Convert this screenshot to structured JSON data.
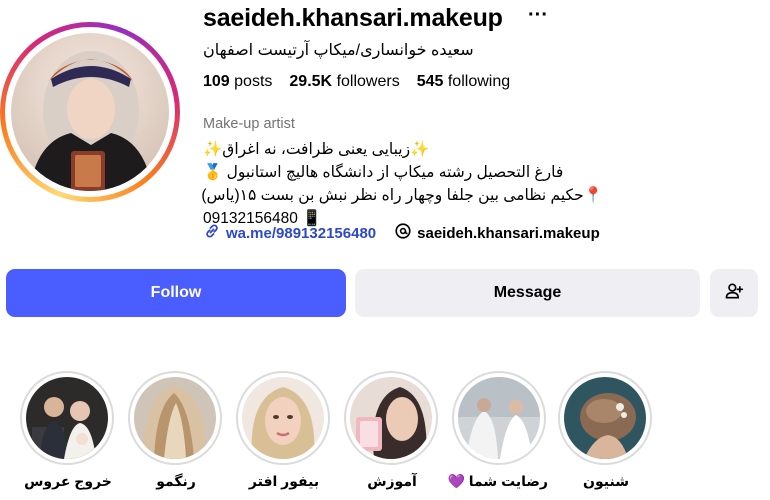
{
  "profile": {
    "username": "saeideh.khansari.makeup",
    "full_name": "سعیده خوانساری/میکاپ آرتیست اصفهان",
    "stats": {
      "posts_count": "109",
      "posts_label": "posts",
      "followers_count": "29.5K",
      "followers_label": "followers",
      "following_count": "545",
      "following_label": "following"
    },
    "category": "Make-up artist",
    "bio": [
      "✨زیبایی یعنی ظرافت، نه اغراق✨",
      "فارغ التحصیل رشته میکاپ از دانشگاه هالیچ استانبول 🥇",
      "📍حکیم نظامی بین جلفا وچهار راه نظر نبش بن بست ۱۵(یاس)",
      "09132156480 📱"
    ],
    "links": {
      "website": "wa.me/989132156480",
      "threads": "saeideh.khansari.makeup"
    }
  },
  "actions": {
    "follow_label": "Follow",
    "message_label": "Message"
  },
  "highlights": [
    {
      "label": "شنیون"
    },
    {
      "label": "رضایت شما 💜"
    },
    {
      "label": "آموزش"
    },
    {
      "label": "بیفور افتر"
    },
    {
      "label": "رنگمو"
    },
    {
      "label": "خروج عروس"
    }
  ],
  "colors": {
    "follow_button": "#4a5dff",
    "secondary_button": "#efeff3",
    "link_blue": "#2d48c9",
    "muted_text": "#737373"
  }
}
